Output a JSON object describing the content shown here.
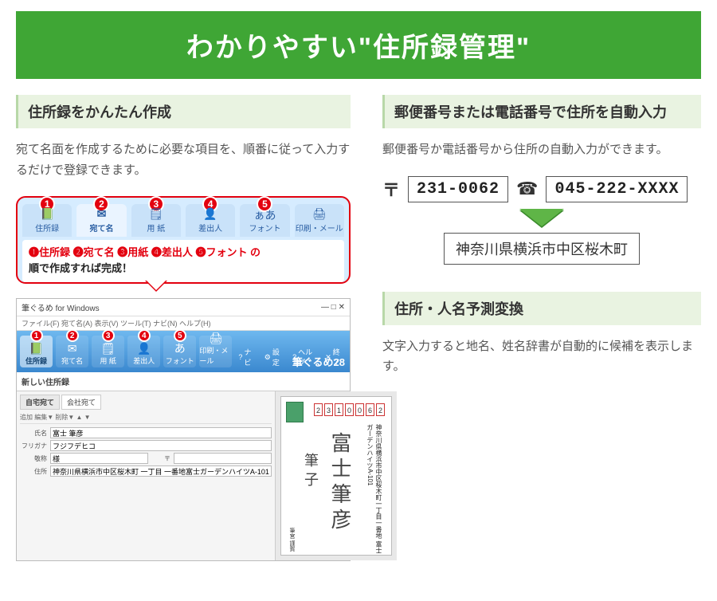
{
  "hero": {
    "title": "わかりやすい\"住所録管理\""
  },
  "left": {
    "heading": "住所録をかんたん作成",
    "body": "宛て名面を作成するために必要な項目を、順番に従って入力するだけで登録できます。",
    "tabs": [
      {
        "label": "住所録",
        "icon": "📗"
      },
      {
        "label": "宛て名",
        "icon": "✉"
      },
      {
        "label": "用 紙",
        "icon": "🗒"
      },
      {
        "label": "差出人",
        "icon": "👤"
      },
      {
        "label": "フォント",
        "icon": "ぁあ"
      },
      {
        "label": "印刷・メール",
        "icon": "🖨"
      }
    ],
    "caption_line1": "❶住所録 ❷宛て名 ❸用紙 ❹差出人 ❺フォント の",
    "caption_line2": "順で作成すれば完成！",
    "app": {
      "title": "筆ぐるめ for Windows",
      "menu": "ファイル(F) 宛て名(A) 表示(V) ツール(T) ナビ(N) ヘルプ(H)",
      "ribbon": [
        "住所録",
        "宛て名",
        "用 紙",
        "差出人",
        "フォント",
        "印刷・メール"
      ],
      "ribbon_right": [
        "ナビ",
        "設定",
        "ヘルプ",
        "終了"
      ],
      "brand": "筆ぐるめ28",
      "book_title": "新しい住所録",
      "nav_tabs": [
        "自宅宛て",
        "会社宛て"
      ],
      "toolbar": "追加  編集▼  削除▼  ▲ ▼",
      "fields": {
        "name_label": "氏名",
        "name_value": "富士 筆彦",
        "kana_label": "フリガナ",
        "kana_value": "フジフデヒコ",
        "suffix_label": "敬称",
        "suffix_value": "様",
        "zip_label": "〒",
        "addr_label": "住所",
        "addr_value": "神奈川県横浜市中区桜木町 一丁目 一番地\n富士ガーデンハイツA-101"
      },
      "preview": {
        "zip": [
          "2",
          "3",
          "1",
          "0",
          "0",
          "6",
          "2"
        ],
        "addr": "神奈川県横浜市中区桜木町一丁目一番地\n富士ガーデンハイツA-101",
        "name_main": "富士筆彦",
        "name_sub": "筆子",
        "from": "筆宮  謹賀"
      }
    }
  },
  "right": {
    "heading1": "郵便番号または電話番号で住所を自動入力",
    "body1": "郵便番号か電話番号から住所の自動入力ができます。",
    "postal_symbol": "〒",
    "postal_value": "231-0062",
    "phone_value": "045-222-XXXX",
    "resolved_address": "神奈川県横浜市中区桜木町",
    "heading2": "住所・人名予測変換",
    "body2": "文字入力すると地名、姓名辞書が自動的に候補を表示します。"
  }
}
